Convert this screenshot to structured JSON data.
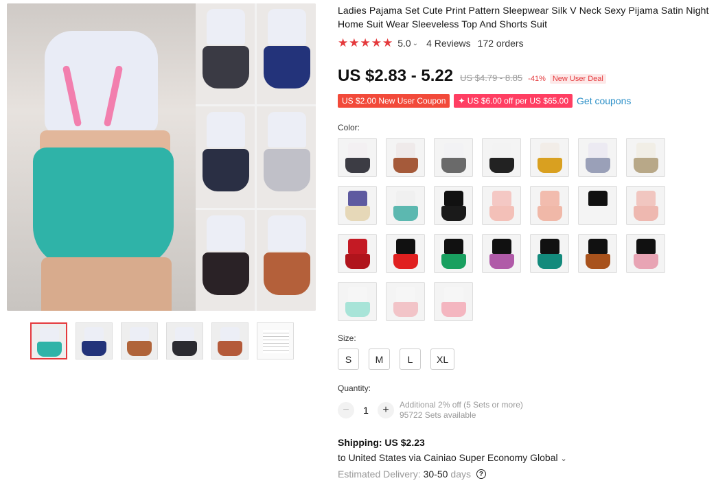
{
  "product": {
    "title": "Ladies Pajama Set Cute Print Pattern Sleepwear Silk V Neck Sexy Pijama Satin Night Home Suit Wear Sleeveless Top And Shorts Suit",
    "rating": "5.0",
    "stars": "★★★★★",
    "reviews": "4 Reviews",
    "orders": "172 orders"
  },
  "price": {
    "current": "US $2.83 - 5.22",
    "original": "US $4.79 - 8.85",
    "discount": "-41%",
    "deal_badge": "New User Deal"
  },
  "coupons": {
    "new_user": "US $2.00 New User Coupon",
    "store": "✦ US $6.00 off per US $65.00",
    "get_link": "Get coupons"
  },
  "color": {
    "label": "Color:",
    "swatches": [
      {
        "top": "#f3f0f2",
        "shorts": "#3c3c44"
      },
      {
        "top": "#efeaea",
        "shorts": "#a55a3a"
      },
      {
        "top": "#f2f2f4",
        "shorts": "#6a6a6a"
      },
      {
        "top": "#f3f3f3",
        "shorts": "#222222"
      },
      {
        "top": "#f2ede8",
        "shorts": "#d9a020"
      },
      {
        "top": "#eceaf2",
        "shorts": "#9aa0b8"
      },
      {
        "top": "#f1eee6",
        "shorts": "#b8a888"
      },
      {
        "top": "#5e5aa0",
        "shorts": "#e6d8b8"
      },
      {
        "top": "#f0f0f0",
        "shorts": "#5cb8b0"
      },
      {
        "top": "#111111",
        "shorts": "#1a1a1a"
      },
      {
        "top": "#f4c8c4",
        "shorts": "#f3c0b8"
      },
      {
        "top": "#f2bcae",
        "shorts": "#f0b8a8"
      },
      {
        "top": "#111111",
        "shorts": "#f4f4f4"
      },
      {
        "top": "#f1c6c0",
        "shorts": "#eeb8b0"
      },
      {
        "top": "#c41a24",
        "shorts": "#b0141c"
      },
      {
        "top": "#111111",
        "shorts": "#e02020"
      },
      {
        "top": "#111111",
        "shorts": "#19a060"
      },
      {
        "top": "#111111",
        "shorts": "#b05aa8"
      },
      {
        "top": "#111111",
        "shorts": "#138a7c"
      },
      {
        "top": "#111111",
        "shorts": "#a8521c"
      },
      {
        "top": "#111111",
        "shorts": "#e8a4b4"
      },
      {
        "top": "#f6f6f6",
        "shorts": "#a8e4d8"
      },
      {
        "top": "#f6f6f6",
        "shorts": "#f2c4c8"
      },
      {
        "top": "#f6f6f6",
        "shorts": "#f4b6c0"
      }
    ]
  },
  "size": {
    "label": "Size:",
    "options": [
      "S",
      "M",
      "L",
      "XL"
    ]
  },
  "quantity": {
    "label": "Quantity:",
    "value": "1",
    "minus": "−",
    "plus": "+",
    "note": "Additional 2% off (5 Sets or more)",
    "available": "95722 Sets available"
  },
  "shipping": {
    "title": "Shipping: US $2.23",
    "route": "to United States via Cainiao Super Economy Global",
    "chevron": "⌄",
    "delivery_label": "Estimated Delivery:",
    "delivery_value": "30-50",
    "delivery_unit": "days",
    "help_icon": "?"
  },
  "gallery": {
    "thumbs": [
      {
        "top": "#eceef6",
        "shorts": "#2fb3a8"
      },
      {
        "top": "#eceef6",
        "shorts": "#23337a"
      },
      {
        "top": "#eceef6",
        "shorts": "#b0643a"
      },
      {
        "top": "#eceef6",
        "shorts": "#2a2a30"
      },
      {
        "top": "#eceef6",
        "shorts": "#b45a3a"
      },
      {
        "chart": true
      }
    ],
    "grid": [
      {
        "shorts": "#3a3a44"
      },
      {
        "shorts": "#23337a"
      },
      {
        "shorts": "#2a2f44"
      },
      {
        "shorts": "#c0c0c8"
      },
      {
        "shorts": "#2a2226"
      },
      {
        "shorts": "#b4603a"
      }
    ]
  }
}
